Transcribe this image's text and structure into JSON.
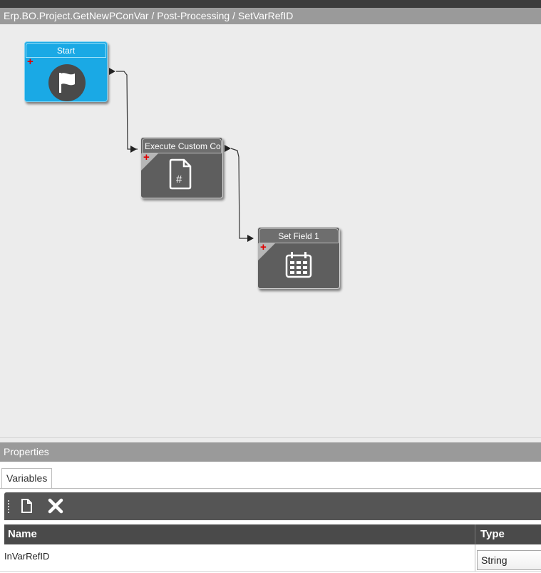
{
  "breadcrumb": "Erp.BO.Project.GetNewPConVar / Post-Processing / SetVarRefID",
  "workflow": {
    "nodes": [
      {
        "title": "Start",
        "icon": "flag-icon",
        "color": "#1aa9e5"
      },
      {
        "title": "Execute Custom Code",
        "icon": "code-file-icon",
        "color": "#5e5e5e"
      },
      {
        "title": "Set Field 1",
        "icon": "calendar-icon",
        "color": "#5e5e5e"
      }
    ]
  },
  "properties": {
    "header": "Properties",
    "tabs": [
      "Variables"
    ],
    "toolbar": {
      "new_icon": "new-document-icon",
      "delete_icon": "delete-x-icon"
    },
    "columns": [
      "Name",
      "Type"
    ],
    "rows": [
      {
        "name": "InVarRefID",
        "type": "String"
      }
    ]
  }
}
